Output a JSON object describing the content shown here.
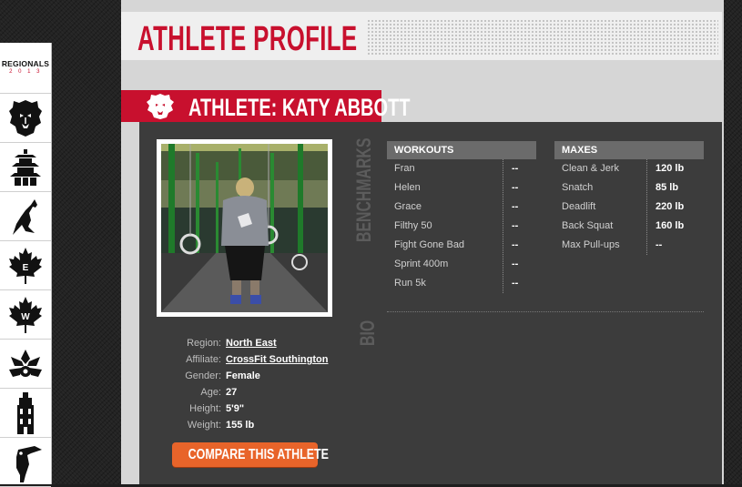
{
  "sidebar": {
    "logo_title": "REGIONALS",
    "logo_year": "2 0 1 3",
    "items": [
      {
        "icon": "lion-icon"
      },
      {
        "icon": "pagoda-icon"
      },
      {
        "icon": "kangaroo-icon"
      },
      {
        "icon": "maple-leaf-icon",
        "letter": "E"
      },
      {
        "icon": "maple-leaf-icon",
        "letter": "W"
      },
      {
        "icon": "flower-icon"
      },
      {
        "icon": "tower-icon"
      },
      {
        "icon": "toucan-icon"
      }
    ]
  },
  "header": {
    "title": "ATHLETE PROFILE"
  },
  "athlete": {
    "banner": "ATHLETE: KATY ABBOTT",
    "details": [
      {
        "label": "Region:",
        "value": "North East",
        "link": true
      },
      {
        "label": "Affiliate:",
        "value": "CrossFit Southington",
        "link": true
      },
      {
        "label": "Gender:",
        "value": "Female",
        "link": false
      },
      {
        "label": "Age:",
        "value": "27",
        "link": false
      },
      {
        "label": "Height:",
        "value": "5'9\"",
        "link": false
      },
      {
        "label": "Weight:",
        "value": "155 lb",
        "link": false
      }
    ],
    "compare_label": "COMPARE THIS ATHLETE"
  },
  "benchmarks": {
    "section_label": "BENCHMARKS",
    "workouts_header": "WORKOUTS",
    "workouts": [
      {
        "name": "Fran",
        "value": "--"
      },
      {
        "name": "Helen",
        "value": "--"
      },
      {
        "name": "Grace",
        "value": "--"
      },
      {
        "name": "Filthy 50",
        "value": "--"
      },
      {
        "name": "Fight Gone Bad",
        "value": "--"
      },
      {
        "name": "Sprint 400m",
        "value": "--"
      },
      {
        "name": "Run 5k",
        "value": "--"
      }
    ],
    "maxes_header": "MAXES",
    "maxes": [
      {
        "name": "Clean & Jerk",
        "value": "120 lb"
      },
      {
        "name": "Snatch",
        "value": "85 lb"
      },
      {
        "name": "Deadlift",
        "value": "220 lb"
      },
      {
        "name": "Back Squat",
        "value": "160 lb"
      },
      {
        "name": "Max Pull-ups",
        "value": "--"
      }
    ]
  },
  "bio": {
    "section_label": "BIO"
  },
  "colors": {
    "accent": "#c8102e",
    "button": "#e8642a",
    "panel": "#3c3c3c"
  }
}
